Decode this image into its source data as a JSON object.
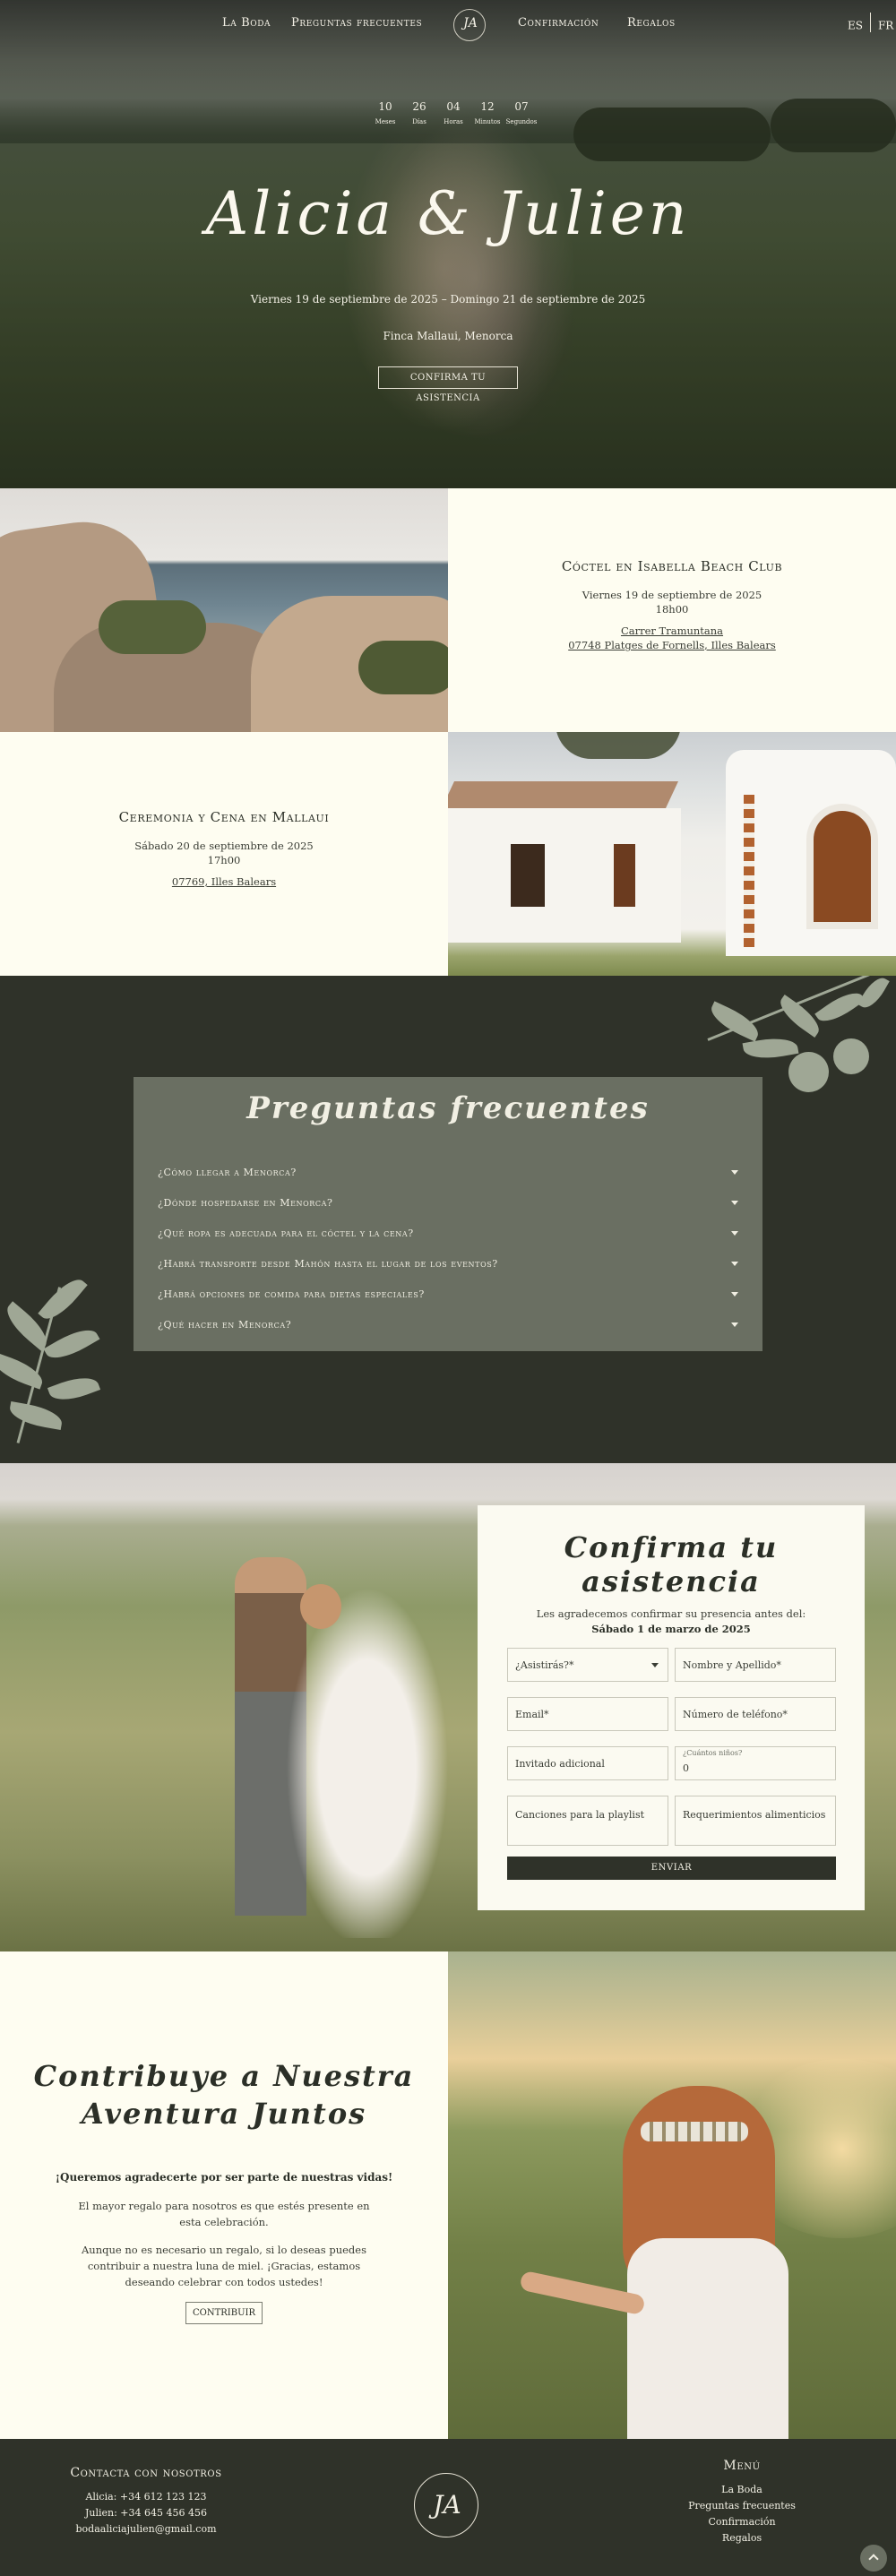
{
  "nav": {
    "links": [
      "La Boda",
      "Preguntas frecuentes",
      "Confirmación",
      "Regalos"
    ],
    "logo_text": "JA",
    "lang": [
      "ES",
      "FR"
    ]
  },
  "countdown": [
    {
      "value": "10",
      "label": "Meses"
    },
    {
      "value": "26",
      "label": "Días"
    },
    {
      "value": "04",
      "label": "Horas"
    },
    {
      "value": "12",
      "label": "Minutos"
    },
    {
      "value": "07",
      "label": "Segundos"
    }
  ],
  "hero": {
    "title": "Alicia & Julien",
    "dates": "Viernes 19 de septiembre de 2025 – Domingo 21 de septiembre de 2025",
    "place": "Finca Mallaui, Menorca",
    "button": "CONFIRMA TU ASISTENCIA"
  },
  "events": [
    {
      "title": "Cóctel en Isabella Beach Club",
      "date": "Viernes 19 de septiembre de 2025",
      "time": "18h00",
      "address1": "Carrer Tramuntana",
      "address2": "07748 Platges de Fornells, Illes Balears"
    },
    {
      "title": "Ceremonia y Cena en Mallaui",
      "date": "Sábado 20 de septiembre de 2025",
      "time": "17h00",
      "address1": "07769, Illes Balears"
    }
  ],
  "faq": {
    "title": "Preguntas frecuentes",
    "items": [
      "¿Cómo llegar a Menorca?",
      "¿Dónde hospedarse en Menorca?",
      "¿Qué ropa es adecuada para el cóctel y la cena?",
      "¿Habrá transporte desde Mahón hasta el lugar de los eventos?",
      "¿Habrá opciones de comida para dietas especiales?",
      "¿Qué hacer en Menorca?"
    ]
  },
  "rsvp": {
    "title": "Confirma tu asistencia",
    "intro": "Les agradecemos confirmar su presencia antes del:",
    "deadline": "Sábado 1 de marzo de 2025",
    "attend_placeholder": "¿Asistirás?*",
    "name_placeholder": "Nombre y Apellido*",
    "email_placeholder": "Email*",
    "phone_placeholder": "Número de teléfono*",
    "guest_placeholder": "Invitado adicional",
    "kids_caption": "¿Cuántos niños?",
    "kids_value": "0",
    "songs_placeholder": "Canciones para la playlist",
    "diet_placeholder": "Requerimientos alimenticios",
    "send": "ENVIAR"
  },
  "contribute": {
    "title_line1": "Contribuye a Nuestra",
    "title_line2": "Aventura Juntos",
    "bold": "¡Queremos agradecerte por ser parte de nuestras vidas!",
    "p1": "El mayor regalo para nosotros es que estés presente en esta celebración.",
    "p2": "Aunque no es necesario un regalo, si lo deseas puedes contribuir a nuestra luna de miel. ¡Gracias, estamos deseando celebrar con todos ustedes!",
    "button": "CONTRIBUIR"
  },
  "footer": {
    "contact_title": "Contacta con nosotros",
    "contact_lines": [
      "Alicia: +34 612 123 123",
      "Julien: +34 645 456 456",
      "bodaaliciajulien@gmail.com"
    ],
    "logo_text": "JA",
    "menu_title": "Menú",
    "menu": [
      "La Boda",
      "Preguntas frecuentes",
      "Confirmación",
      "Regalos"
    ]
  }
}
